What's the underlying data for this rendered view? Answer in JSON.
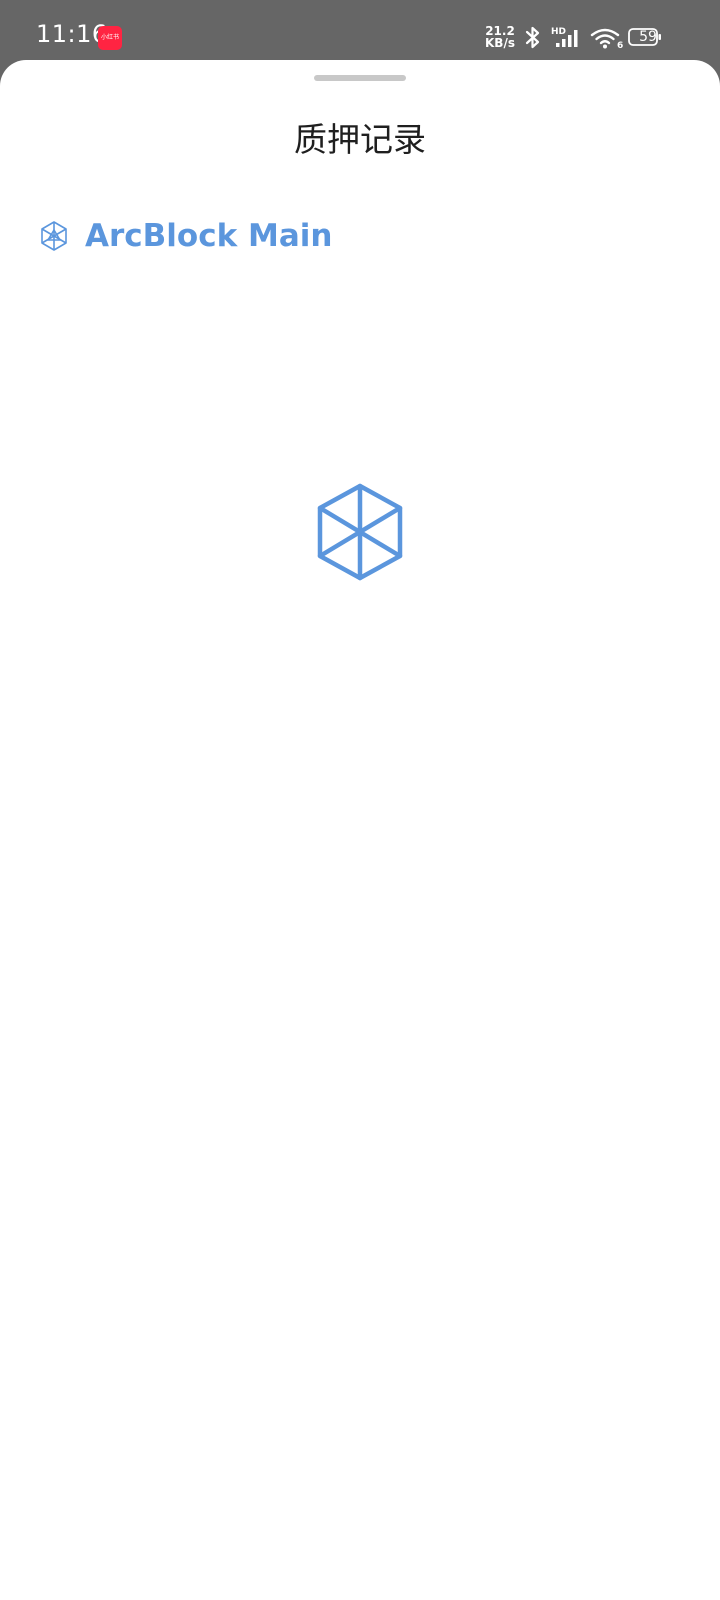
{
  "status_bar": {
    "time": "11:16",
    "app_badge_label": "小红书",
    "net_speed_value": "21.2",
    "net_speed_unit": "KB/s",
    "network_type": "HD",
    "wifi_band": "6",
    "battery_level": "59",
    "icons": [
      "bluetooth-icon",
      "signal-icon",
      "wifi-icon",
      "battery-icon"
    ]
  },
  "sheet": {
    "title": "质押记录",
    "chain": {
      "name": "ArcBlock Main",
      "icon": "arcblock-icon",
      "color": "#5b96dd"
    },
    "loading_icon": "arcblock-loading-icon"
  },
  "colors": {
    "status_bar_bg": "#666666",
    "accent": "#5b96dd",
    "app_badge": "#ff2442"
  }
}
